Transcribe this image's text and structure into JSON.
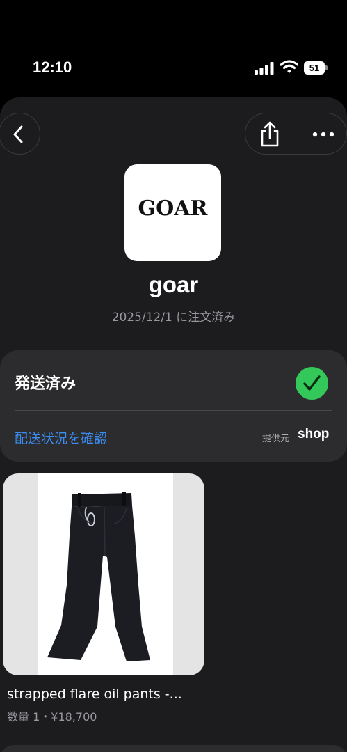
{
  "status_bar": {
    "time": "12:10",
    "battery": "51",
    "icons": [
      "signal-icon",
      "wifi-icon",
      "battery-icon"
    ]
  },
  "nav": {
    "icons": [
      "back-chevron-icon",
      "share-icon",
      "more-dots-icon"
    ]
  },
  "shop": {
    "logo_text": "GOAR",
    "name": "goar",
    "order_date": "2025/12/1 に注文済み"
  },
  "shipping": {
    "status": "発送済み",
    "track_link": "配送状況を確認",
    "provided_by": "提供元",
    "provider": "shop",
    "status_color": "#34c759",
    "link_color": "#3a8df2"
  },
  "product": {
    "title": "strapped flare oil pants -...",
    "meta": "数量 1・¥18,700"
  }
}
